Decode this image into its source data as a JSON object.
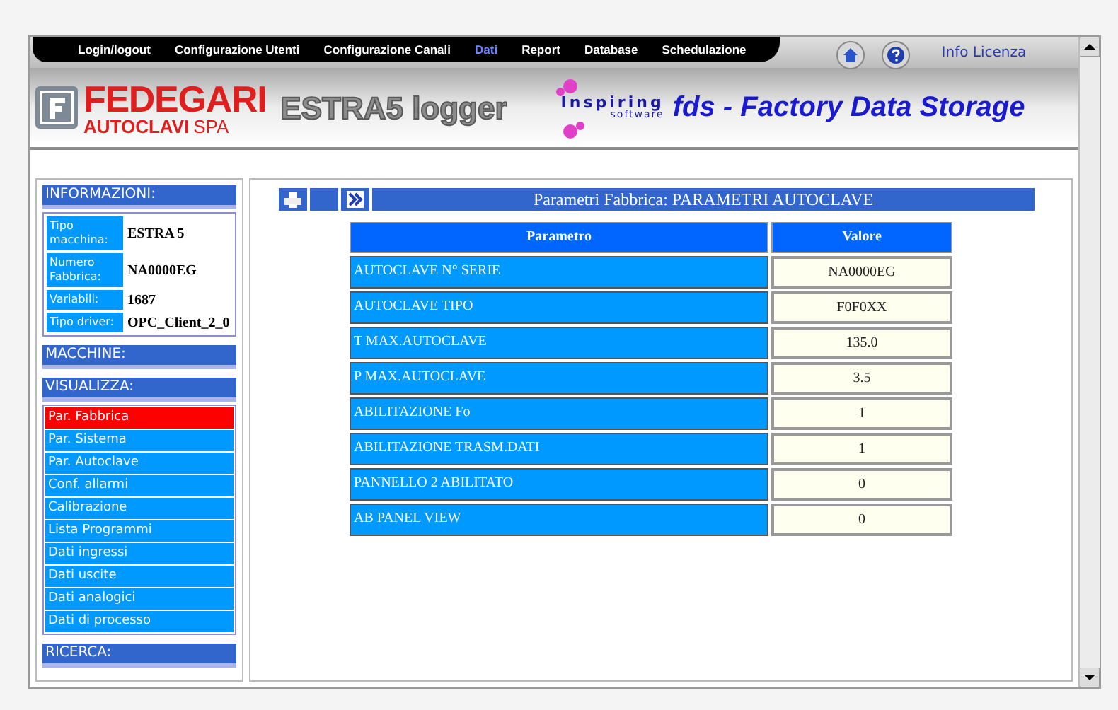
{
  "nav": {
    "items": [
      {
        "label": "Login/logout",
        "selected": false
      },
      {
        "label": "Configurazione Utenti",
        "selected": false
      },
      {
        "label": "Configurazione Canali",
        "selected": false
      },
      {
        "label": "Dati",
        "selected": true
      },
      {
        "label": "Report",
        "selected": false
      },
      {
        "label": "Database",
        "selected": false
      },
      {
        "label": "Schedulazione",
        "selected": false
      }
    ],
    "info_link": "Info Licenza"
  },
  "header": {
    "brand": "FEDEGARI",
    "brand_sub": "AUTOCLAVI",
    "brand_sub2": "SPA",
    "product": "ESTRA5 logger",
    "partner": "Inspiring",
    "partner_sub": "software",
    "tagline": "fds - Factory Data Storage"
  },
  "sidebar": {
    "info_title": "INFORMAZIONI:",
    "info_rows": [
      {
        "label": "Tipo macchina:",
        "value": "ESTRA 5"
      },
      {
        "label": "Numero Fabbrica:",
        "value": "NA0000EG"
      },
      {
        "label": "Variabili:",
        "value": "1687"
      },
      {
        "label": "Tipo driver:",
        "value": "OPC_Client_2_0"
      }
    ],
    "machines_title": "MACCHINE:",
    "view_title": "VISUALIZZA:",
    "view_items": [
      {
        "label": "Par. Fabbrica",
        "selected": true
      },
      {
        "label": "Par. Sistema",
        "selected": false
      },
      {
        "label": "Par. Autoclave",
        "selected": false
      },
      {
        "label": "Conf. allarmi",
        "selected": false
      },
      {
        "label": "Calibrazione",
        "selected": false
      },
      {
        "label": "Lista Programmi",
        "selected": false
      },
      {
        "label": "Dati ingressi",
        "selected": false
      },
      {
        "label": "Dati uscite",
        "selected": false
      },
      {
        "label": "Dati analogici",
        "selected": false
      },
      {
        "label": "Dati di processo",
        "selected": false
      }
    ],
    "search_title": "RICERCA:"
  },
  "main": {
    "title": "Parametri Fabbrica: PARAMETRI AUTOCLAVE",
    "table": {
      "columns": [
        "Parametro",
        "Valore"
      ],
      "rows": [
        [
          "AUTOCLAVE N° SERIE",
          "NA0000EG"
        ],
        [
          "AUTOCLAVE TIPO",
          "F0F0XX"
        ],
        [
          "T MAX.AUTOCLAVE",
          "135.0"
        ],
        [
          "P MAX.AUTOCLAVE",
          "3.5"
        ],
        [
          "ABILITAZIONE Fo",
          "1"
        ],
        [
          "ABILITAZIONE TRASM.DATI",
          "1"
        ],
        [
          "PANNELLO 2 ABILITATO",
          "0"
        ],
        [
          "AB PANEL VIEW",
          "0"
        ]
      ]
    }
  }
}
